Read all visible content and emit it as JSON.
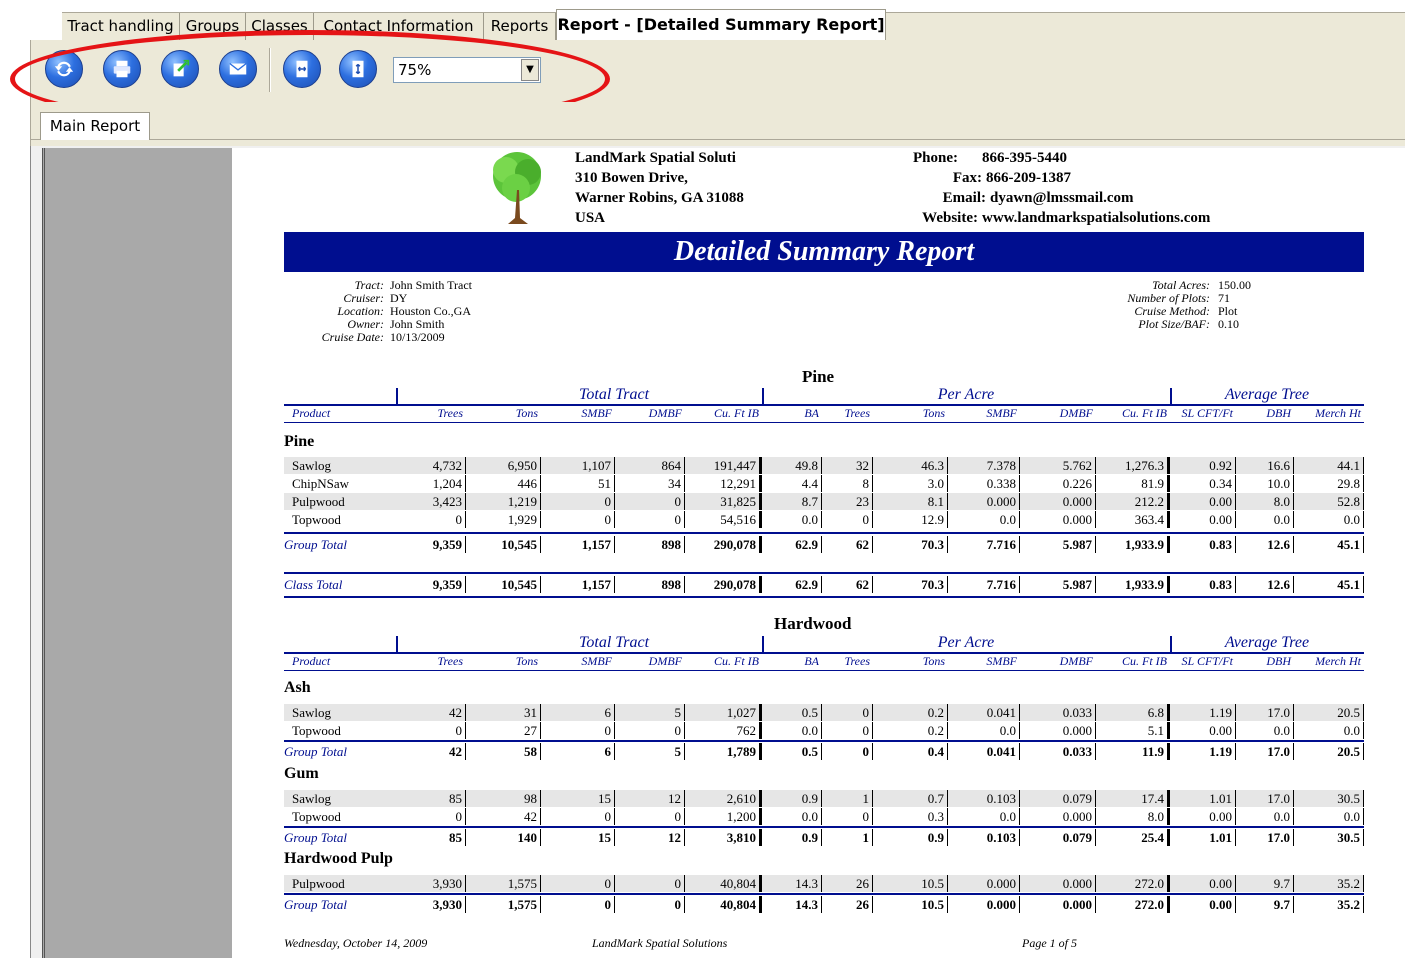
{
  "tabs": [
    {
      "label": "Tract handling"
    },
    {
      "label": "Groups"
    },
    {
      "label": "Classes"
    },
    {
      "label": "Contact Information"
    },
    {
      "label": "Reports"
    },
    {
      "label": "Report - [Detailed Summary Report]"
    }
  ],
  "toolbar": {
    "zoom_value": "75%",
    "buttons": [
      "refresh-icon",
      "print-icon",
      "export-icon",
      "email-icon",
      "fit-width-icon",
      "fit-height-icon"
    ]
  },
  "subtab": {
    "label": "Main Report"
  },
  "report": {
    "company": {
      "name": "LandMark Spatial Soluti",
      "address1": "310 Bowen Drive,",
      "address2": "Warner Robins, GA 31088",
      "country": "USA"
    },
    "contact": {
      "phone_label": "Phone:",
      "phone": "866-395-5440",
      "fax_label": "Fax:",
      "fax": "866-209-1387",
      "email_label": "Email:",
      "email": "dyawn@lmssmail.com",
      "website_label": "Website:",
      "website": "www.landmarkspatialsolutions.com"
    },
    "title": "Detailed Summary Report",
    "info_left": [
      {
        "label": "Tract:",
        "value": "John Smith Tract"
      },
      {
        "label": "Cruiser:",
        "value": "DY"
      },
      {
        "label": "Location:",
        "value": "Houston Co.,GA"
      },
      {
        "label": "Owner:",
        "value": "John Smith"
      },
      {
        "label": "Cruise Date:",
        "value": "10/13/2009"
      }
    ],
    "info_right": [
      {
        "label": "Total Acres:",
        "value": "150.00"
      },
      {
        "label": "Number of Plots:",
        "value": "71"
      },
      {
        "label": "Cruise Method:",
        "value": "Plot"
      },
      {
        "label": "Plot Size/BAF:",
        "value": "0.10"
      }
    ],
    "group_headers": {
      "total_tract": "Total Tract",
      "per_acre": "Per Acre",
      "average_tree": "Average Tree"
    },
    "columns": [
      "Product",
      "Trees",
      "Tons",
      "SMBF",
      "DMBF",
      "Cu. Ft IB",
      "BA",
      "Trees",
      "Tons",
      "SMBF",
      "DMBF",
      "Cu. Ft IB",
      "SL CFT/Ft",
      "DBH",
      "Merch Ht"
    ],
    "sections": [
      {
        "title": "Pine",
        "groups": [
          {
            "name": "Pine",
            "rows": [
              [
                "Sawlog",
                "4,732",
                "6,950",
                "1,107",
                "864",
                "191,447",
                "49.8",
                "32",
                "46.3",
                "7.378",
                "5.762",
                "1,276.3",
                "0.92",
                "16.6",
                "44.1"
              ],
              [
                "ChipNSaw",
                "1,204",
                "446",
                "51",
                "34",
                "12,291",
                "4.4",
                "8",
                "3.0",
                "0.338",
                "0.226",
                "81.9",
                "0.34",
                "10.0",
                "29.8"
              ],
              [
                "Pulpwood",
                "3,423",
                "1,219",
                "0",
                "0",
                "31,825",
                "8.7",
                "23",
                "8.1",
                "0.000",
                "0.000",
                "212.2",
                "0.00",
                "8.0",
                "52.8"
              ],
              [
                "Topwood",
                "0",
                "1,929",
                "0",
                "0",
                "54,516",
                "0.0",
                "0",
                "12.9",
                "0.0",
                "0.000",
                "363.4",
                "0.00",
                "0.0",
                "0.0"
              ]
            ],
            "total": [
              "Group Total",
              "9,359",
              "10,545",
              "1,157",
              "898",
              "290,078",
              "62.9",
              "62",
              "70.3",
              "7.716",
              "5.987",
              "1,933.9",
              "0.83",
              "12.6",
              "45.1"
            ]
          }
        ],
        "class_total": [
          "Class Total",
          "9,359",
          "10,545",
          "1,157",
          "898",
          "290,078",
          "62.9",
          "62",
          "70.3",
          "7.716",
          "5.987",
          "1,933.9",
          "0.83",
          "12.6",
          "45.1"
        ]
      },
      {
        "title": "Hardwood",
        "groups": [
          {
            "name": "Ash",
            "rows": [
              [
                "Sawlog",
                "42",
                "31",
                "6",
                "5",
                "1,027",
                "0.5",
                "0",
                "0.2",
                "0.041",
                "0.033",
                "6.8",
                "1.19",
                "17.0",
                "20.5"
              ],
              [
                "Topwood",
                "0",
                "27",
                "0",
                "0",
                "762",
                "0.0",
                "0",
                "0.2",
                "0.0",
                "0.000",
                "5.1",
                "0.00",
                "0.0",
                "0.0"
              ]
            ],
            "total": [
              "Group Total",
              "42",
              "58",
              "6",
              "5",
              "1,789",
              "0.5",
              "0",
              "0.4",
              "0.041",
              "0.033",
              "11.9",
              "1.19",
              "17.0",
              "20.5"
            ]
          },
          {
            "name": "Gum",
            "rows": [
              [
                "Sawlog",
                "85",
                "98",
                "15",
                "12",
                "2,610",
                "0.9",
                "1",
                "0.7",
                "0.103",
                "0.079",
                "17.4",
                "1.01",
                "17.0",
                "30.5"
              ],
              [
                "Topwood",
                "0",
                "42",
                "0",
                "0",
                "1,200",
                "0.0",
                "0",
                "0.3",
                "0.0",
                "0.000",
                "8.0",
                "0.00",
                "0.0",
                "0.0"
              ]
            ],
            "total": [
              "Group Total",
              "85",
              "140",
              "15",
              "12",
              "3,810",
              "0.9",
              "1",
              "0.9",
              "0.103",
              "0.079",
              "25.4",
              "1.01",
              "17.0",
              "30.5"
            ]
          },
          {
            "name": "Hardwood Pulp",
            "rows": [
              [
                "Pulpwood",
                "3,930",
                "1,575",
                "0",
                "0",
                "40,804",
                "14.3",
                "26",
                "10.5",
                "0.000",
                "0.000",
                "272.0",
                "0.00",
                "9.7",
                "35.2"
              ]
            ],
            "total": [
              "Group Total",
              "3,930",
              "1,575",
              "0",
              "0",
              "40,804",
              "14.3",
              "26",
              "10.5",
              "0.000",
              "0.000",
              "272.0",
              "0.00",
              "9.7",
              "35.2"
            ]
          }
        ]
      }
    ],
    "footer": {
      "date": "Wednesday, October 14, 2009",
      "company": "LandMark Spatial Solutions",
      "page": "Page 1 of 5"
    }
  }
}
